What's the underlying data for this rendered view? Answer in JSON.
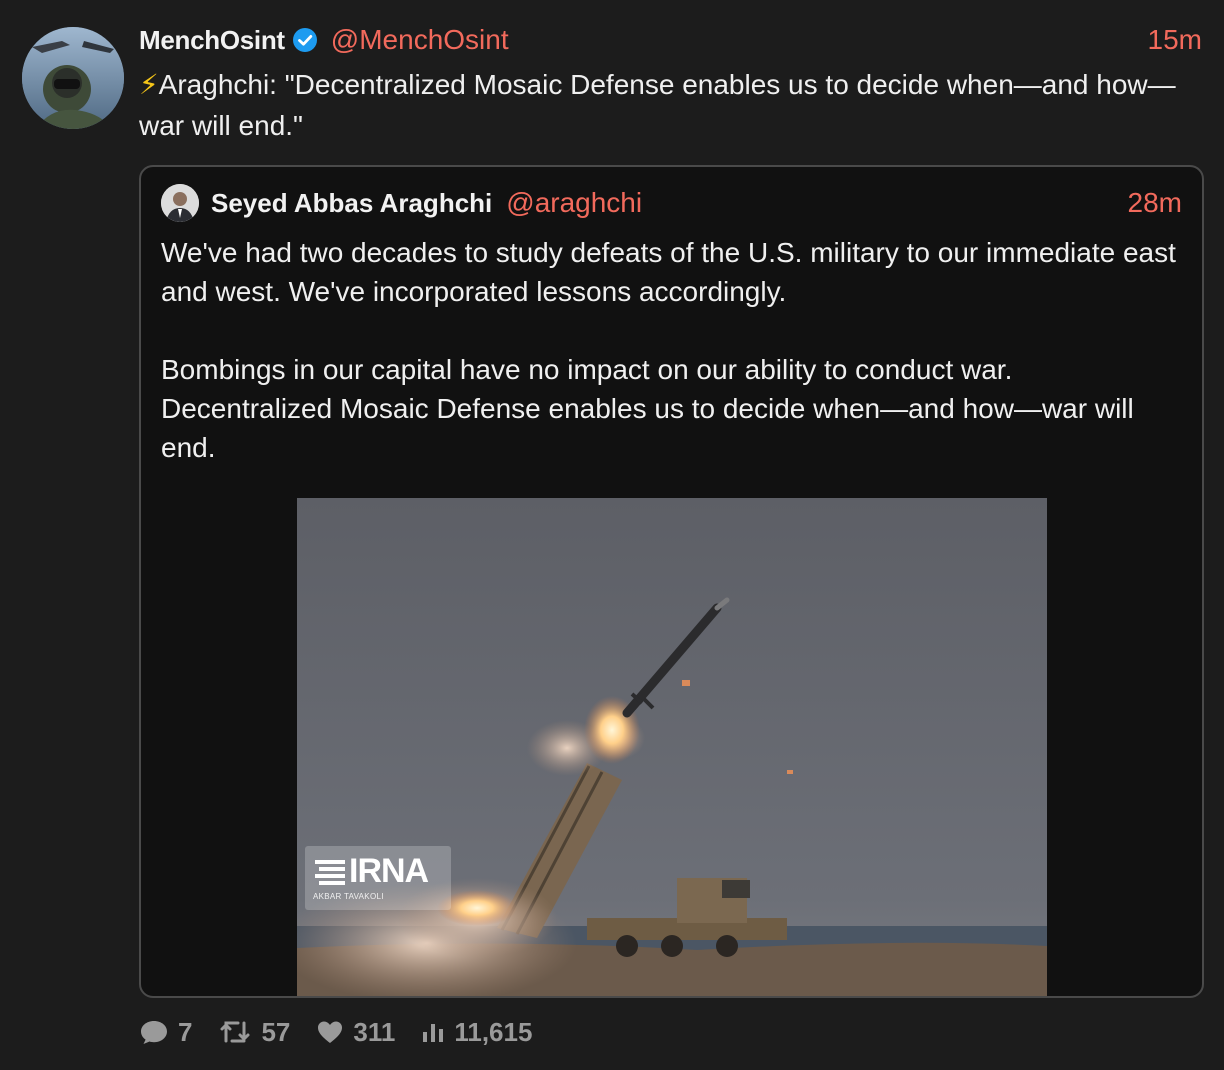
{
  "tweet": {
    "display_name": "MenchOsint",
    "verified": true,
    "handle": "@MenchOsint",
    "time": "15m",
    "text": "⚡Araghchi: \"Decentralized Mosaic Defense enables us to decide when—and how—war will end.\""
  },
  "quoted": {
    "display_name": "Seyed Abbas Araghchi",
    "handle": "@araghchi",
    "time": "28m",
    "paragraph_1": "We've had two decades to study defeats of the U.S. military to our immediate east and west. We've incorporated lessons accordingly.",
    "paragraph_2": "Bombings in our capital have no impact on our ability to conduct war. Decentralized Mosaic Defense enables us to decide when—and how—war will end.",
    "media": {
      "watermark": "IRNA",
      "credit": "AKBAR TAVAKOLI"
    }
  },
  "actions": {
    "replies": "7",
    "retweets": "57",
    "likes": "311",
    "views": "11,615"
  },
  "colors": {
    "accent": "#f26a5c",
    "background": "#1c1c1c",
    "verified": "#1d9bf0"
  }
}
